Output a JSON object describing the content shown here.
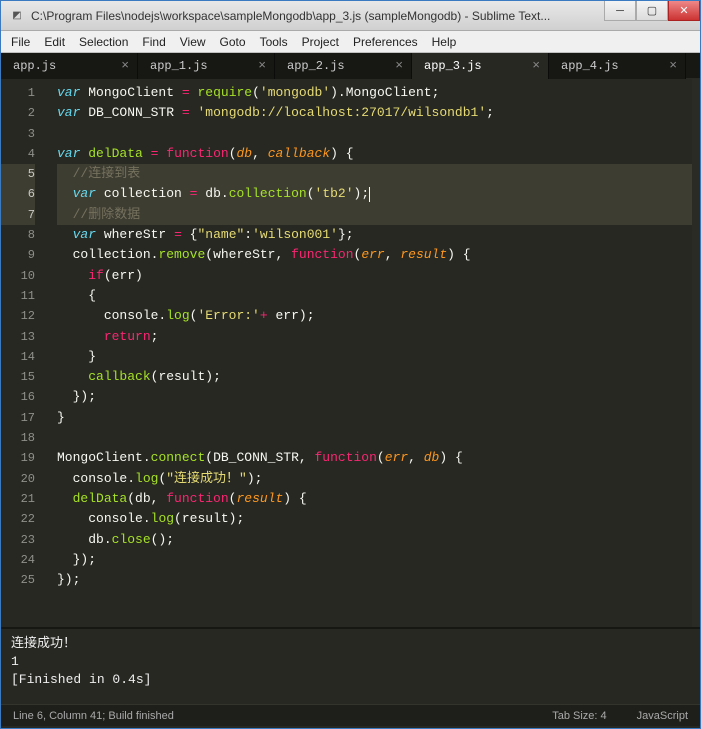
{
  "window": {
    "title": "C:\\Program Files\\nodejs\\workspace\\sampleMongodb\\app_3.js (sampleMongodb) - Sublime Text..."
  },
  "menu": {
    "items": [
      "File",
      "Edit",
      "Selection",
      "Find",
      "View",
      "Goto",
      "Tools",
      "Project",
      "Preferences",
      "Help"
    ]
  },
  "tabs": [
    {
      "label": "app.js",
      "active": false
    },
    {
      "label": "app_1.js",
      "active": false
    },
    {
      "label": "app_2.js",
      "active": false
    },
    {
      "label": "app_3.js",
      "active": true
    },
    {
      "label": "app_4.js",
      "active": false
    }
  ],
  "code_lines": [
    {
      "n": 1,
      "active": false,
      "tokens": [
        [
          "decl",
          "var"
        ],
        [
          "punc",
          " "
        ],
        [
          "name",
          "MongoClient"
        ],
        [
          "punc",
          " "
        ],
        [
          "op",
          "="
        ],
        [
          "punc",
          " "
        ],
        [
          "fn",
          "require"
        ],
        [
          "punc",
          "("
        ],
        [
          "str",
          "'mongodb'"
        ],
        [
          "punc",
          ")."
        ],
        [
          "name",
          "MongoClient"
        ],
        [
          "punc",
          ";"
        ]
      ]
    },
    {
      "n": 2,
      "active": false,
      "tokens": [
        [
          "decl",
          "var"
        ],
        [
          "punc",
          " "
        ],
        [
          "name",
          "DB_CONN_STR"
        ],
        [
          "punc",
          " "
        ],
        [
          "op",
          "="
        ],
        [
          "punc",
          " "
        ],
        [
          "str",
          "'mongodb://localhost:27017/wilsondb1'"
        ],
        [
          "punc",
          ";"
        ]
      ]
    },
    {
      "n": 3,
      "active": false,
      "tokens": []
    },
    {
      "n": 4,
      "active": false,
      "tokens": [
        [
          "decl",
          "var"
        ],
        [
          "punc",
          " "
        ],
        [
          "fn",
          "delData"
        ],
        [
          "punc",
          " "
        ],
        [
          "op",
          "="
        ],
        [
          "punc",
          " "
        ],
        [
          "stor",
          "function"
        ],
        [
          "punc",
          "("
        ],
        [
          "param",
          "db"
        ],
        [
          "punc",
          ", "
        ],
        [
          "param",
          "callback"
        ],
        [
          "punc",
          ") {"
        ]
      ]
    },
    {
      "n": 5,
      "active": true,
      "tokens": [
        [
          "punc",
          "  "
        ],
        [
          "cmt",
          "//连接到表"
        ]
      ]
    },
    {
      "n": 6,
      "active": true,
      "tokens": [
        [
          "punc",
          "  "
        ],
        [
          "decl",
          "var"
        ],
        [
          "punc",
          " "
        ],
        [
          "name",
          "collection"
        ],
        [
          "punc",
          " "
        ],
        [
          "op",
          "="
        ],
        [
          "punc",
          " "
        ],
        [
          "name",
          "db"
        ],
        [
          "punc",
          "."
        ],
        [
          "fn",
          "collection"
        ],
        [
          "punc",
          "("
        ],
        [
          "str",
          "'tb2'"
        ],
        [
          "punc",
          ");"
        ],
        [
          "caret",
          ""
        ]
      ]
    },
    {
      "n": 7,
      "active": true,
      "tokens": [
        [
          "punc",
          "  "
        ],
        [
          "cmt",
          "//删除数据"
        ]
      ]
    },
    {
      "n": 8,
      "active": false,
      "tokens": [
        [
          "punc",
          "  "
        ],
        [
          "decl",
          "var"
        ],
        [
          "punc",
          " "
        ],
        [
          "name",
          "whereStr"
        ],
        [
          "punc",
          " "
        ],
        [
          "op",
          "="
        ],
        [
          "punc",
          " {"
        ],
        [
          "str",
          "\"name\""
        ],
        [
          "punc",
          ":"
        ],
        [
          "str",
          "'wilson001'"
        ],
        [
          "punc",
          "};"
        ]
      ]
    },
    {
      "n": 9,
      "active": false,
      "tokens": [
        [
          "punc",
          "  "
        ],
        [
          "name",
          "collection"
        ],
        [
          "punc",
          "."
        ],
        [
          "fn",
          "remove"
        ],
        [
          "punc",
          "("
        ],
        [
          "name",
          "whereStr"
        ],
        [
          "punc",
          ", "
        ],
        [
          "stor",
          "function"
        ],
        [
          "punc",
          "("
        ],
        [
          "param",
          "err"
        ],
        [
          "punc",
          ", "
        ],
        [
          "param",
          "result"
        ],
        [
          "punc",
          ") {"
        ]
      ]
    },
    {
      "n": 10,
      "active": false,
      "tokens": [
        [
          "punc",
          "    "
        ],
        [
          "stor",
          "if"
        ],
        [
          "punc",
          "("
        ],
        [
          "name",
          "err"
        ],
        [
          "punc",
          ")"
        ]
      ]
    },
    {
      "n": 11,
      "active": false,
      "tokens": [
        [
          "punc",
          "    {"
        ]
      ]
    },
    {
      "n": 12,
      "active": false,
      "tokens": [
        [
          "punc",
          "      "
        ],
        [
          "name",
          "console"
        ],
        [
          "punc",
          "."
        ],
        [
          "fn",
          "log"
        ],
        [
          "punc",
          "("
        ],
        [
          "str",
          "'Error:'"
        ],
        [
          "op",
          "+"
        ],
        [
          "punc",
          " "
        ],
        [
          "name",
          "err"
        ],
        [
          "punc",
          ");"
        ]
      ]
    },
    {
      "n": 13,
      "active": false,
      "tokens": [
        [
          "punc",
          "      "
        ],
        [
          "stor",
          "return"
        ],
        [
          "punc",
          ";"
        ]
      ]
    },
    {
      "n": 14,
      "active": false,
      "tokens": [
        [
          "punc",
          "    }"
        ]
      ]
    },
    {
      "n": 15,
      "active": false,
      "tokens": [
        [
          "punc",
          "    "
        ],
        [
          "fn",
          "callback"
        ],
        [
          "punc",
          "("
        ],
        [
          "name",
          "result"
        ],
        [
          "punc",
          ");"
        ]
      ]
    },
    {
      "n": 16,
      "active": false,
      "tokens": [
        [
          "punc",
          "  });"
        ]
      ]
    },
    {
      "n": 17,
      "active": false,
      "tokens": [
        [
          "punc",
          "}"
        ]
      ]
    },
    {
      "n": 18,
      "active": false,
      "tokens": []
    },
    {
      "n": 19,
      "active": false,
      "tokens": [
        [
          "name",
          "MongoClient"
        ],
        [
          "punc",
          "."
        ],
        [
          "fn",
          "connect"
        ],
        [
          "punc",
          "("
        ],
        [
          "name",
          "DB_CONN_STR"
        ],
        [
          "punc",
          ", "
        ],
        [
          "stor",
          "function"
        ],
        [
          "punc",
          "("
        ],
        [
          "param",
          "err"
        ],
        [
          "punc",
          ", "
        ],
        [
          "param",
          "db"
        ],
        [
          "punc",
          ") {"
        ]
      ]
    },
    {
      "n": 20,
      "active": false,
      "tokens": [
        [
          "punc",
          "  "
        ],
        [
          "name",
          "console"
        ],
        [
          "punc",
          "."
        ],
        [
          "fn",
          "log"
        ],
        [
          "punc",
          "("
        ],
        [
          "str",
          "\"连接成功！\""
        ],
        [
          "punc",
          ");"
        ]
      ]
    },
    {
      "n": 21,
      "active": false,
      "tokens": [
        [
          "punc",
          "  "
        ],
        [
          "fn",
          "delData"
        ],
        [
          "punc",
          "("
        ],
        [
          "name",
          "db"
        ],
        [
          "punc",
          ", "
        ],
        [
          "stor",
          "function"
        ],
        [
          "punc",
          "("
        ],
        [
          "param",
          "result"
        ],
        [
          "punc",
          ") {"
        ]
      ]
    },
    {
      "n": 22,
      "active": false,
      "tokens": [
        [
          "punc",
          "    "
        ],
        [
          "name",
          "console"
        ],
        [
          "punc",
          "."
        ],
        [
          "fn",
          "log"
        ],
        [
          "punc",
          "("
        ],
        [
          "name",
          "result"
        ],
        [
          "punc",
          ");"
        ]
      ]
    },
    {
      "n": 23,
      "active": false,
      "tokens": [
        [
          "punc",
          "    "
        ],
        [
          "name",
          "db"
        ],
        [
          "punc",
          "."
        ],
        [
          "fn",
          "close"
        ],
        [
          "punc",
          "();"
        ]
      ]
    },
    {
      "n": 24,
      "active": false,
      "tokens": [
        [
          "punc",
          "  });"
        ]
      ]
    },
    {
      "n": 25,
      "active": false,
      "tokens": [
        [
          "punc",
          "});"
        ]
      ]
    }
  ],
  "console": {
    "lines": [
      "连接成功！",
      "1",
      "[Finished in 0.4s]"
    ]
  },
  "status": {
    "left": "Line 6, Column 41; Build finished",
    "tabsize": "Tab Size: 4",
    "syntax": "JavaScript"
  }
}
